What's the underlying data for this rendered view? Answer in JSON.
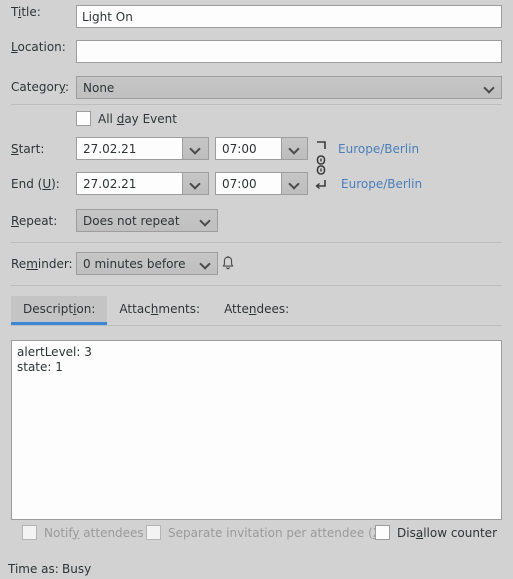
{
  "form": {
    "title": {
      "label": "Title:",
      "mnemonic": "i",
      "value": "Light On",
      "placeholder": ""
    },
    "location": {
      "label": "Location:",
      "mnemonic": "L",
      "value": "",
      "placeholder": ""
    },
    "category": {
      "label": "Category:",
      "mnemonic": "y",
      "value": "None",
      "options": [
        "None"
      ]
    },
    "all_day": {
      "label_pre": "All ",
      "mnemonic": "d",
      "label_post": "ay Event",
      "checked": false
    },
    "start": {
      "label": "Start:",
      "mnemonic": "S",
      "date": "27.02.21",
      "time": "07:00",
      "timezone": "Europe/Berlin"
    },
    "end": {
      "label_pre": "End (",
      "mnemonic": "U",
      "label_post": "):",
      "date": "27.02.21",
      "time": "07:00",
      "timezone": "Europe/Berlin"
    },
    "repeat": {
      "label": "Repeat:",
      "mnemonic": "R",
      "value": "Does not repeat",
      "options": [
        "Does not repeat"
      ]
    },
    "reminder": {
      "label_pre": "Re",
      "mnemonic": "m",
      "label_post": "inder:",
      "value": "0 minutes before",
      "options": [
        "0 minutes before"
      ],
      "bell_icon": "bell-icon"
    },
    "link_icon": "link-chain-icon"
  },
  "tabs": [
    {
      "label_pre": "Descript",
      "mnemonic": "i",
      "label_post": "on:",
      "active": true
    },
    {
      "label_pre": "Attac",
      "mnemonic": "h",
      "label_post": "ments:",
      "active": false
    },
    {
      "label_pre": "Atte",
      "mnemonic": "n",
      "label_post": "dees:",
      "active": false
    }
  ],
  "description": {
    "text": "alertLevel: 3\nstate: 1",
    "placeholder": ""
  },
  "bottom_checkboxes": [
    {
      "label_pre": "Notif",
      "mnemonic": "y",
      "label_post": " attendees",
      "checked": false,
      "disabled": true
    },
    {
      "label_pre": "Separate invitation per attendee (",
      "mnemonic": "X",
      "label_post": ")",
      "checked": false,
      "disabled": true
    },
    {
      "label_pre": "Dis",
      "mnemonic": "a",
      "label_post": "llow counter",
      "checked": false,
      "disabled": false
    }
  ],
  "status": {
    "time_as_label": "Time as:",
    "time_as_value": "Busy"
  },
  "colors": {
    "background": "#d2d2d2",
    "field_background": "#fdfdfd",
    "border": "#9d9d9d",
    "link": "#4a7ebb",
    "tab_accent": "#3b87d3",
    "disabled_text": "#9a9a9a",
    "text": "#2e3436"
  }
}
